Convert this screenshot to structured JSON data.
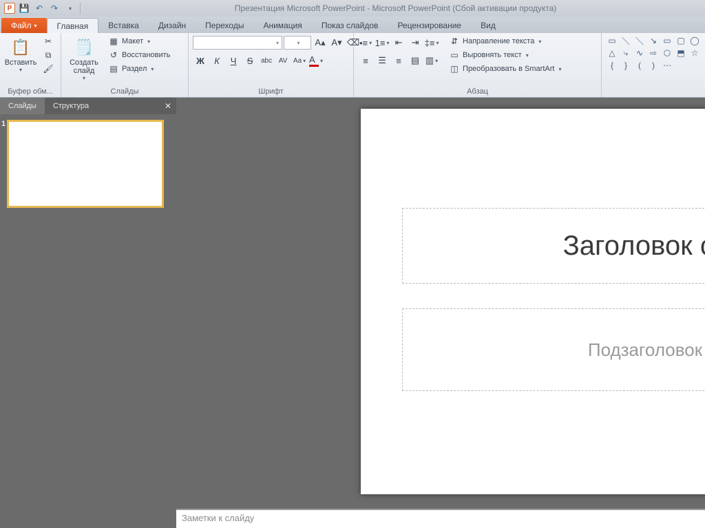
{
  "titlebar": {
    "title": "Презентация Microsoft PowerPoint  -  Microsoft PowerPoint (Сбой активации продукта)"
  },
  "tabs": {
    "file": "Файл",
    "items": [
      "Главная",
      "Вставка",
      "Дизайн",
      "Переходы",
      "Анимация",
      "Показ слайдов",
      "Рецензирование",
      "Вид"
    ],
    "active": "Главная"
  },
  "ribbon": {
    "clipboard": {
      "paste": "Вставить",
      "group": "Буфер обм..."
    },
    "slides": {
      "new": "Создать\nслайд",
      "layout": "Макет",
      "reset": "Восстановить",
      "section": "Раздел",
      "group": "Слайды"
    },
    "font": {
      "group": "Шрифт",
      "bold": "Ж",
      "italic": "К",
      "underline": "Ч",
      "strike": "S",
      "shadow": "abc",
      "spacing": "AV",
      "case": "Aa"
    },
    "paragraph": {
      "group": "Абзац",
      "textdir": "Направление текста",
      "align": "Выровнять текст",
      "smartart": "Преобразовать в SmartArt"
    }
  },
  "leftpane": {
    "tab_slides": "Слайды",
    "tab_outline": "Структура",
    "thumb_num": "1"
  },
  "slide": {
    "title_placeholder": "Заголовок слайда",
    "subtitle_placeholder": "Подзаголовок слайда"
  },
  "notes": {
    "placeholder": "Заметки к слайду"
  }
}
